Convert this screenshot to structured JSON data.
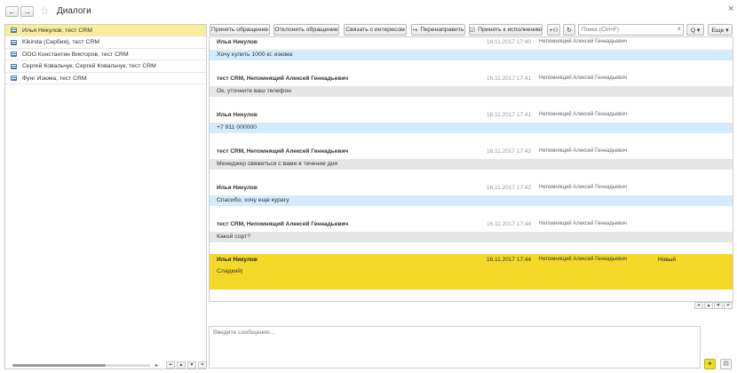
{
  "window": {
    "title": "Диалоги",
    "close": "×"
  },
  "nav": {
    "back": "←",
    "forward": "→",
    "star": "☆"
  },
  "toolbar": {
    "accept": "Принять обращение",
    "reject": "Отклонить обращение",
    "link_interest": "Связать с интересом",
    "redirect": "Перенаправить",
    "accept_exec": "Принять к исполнению",
    "search_placeholder": "Поиск (Ctrl+F)",
    "search_clear": "×",
    "search_btn": "Q ▾",
    "more": "Еще ▾"
  },
  "dialogs": [
    {
      "label": "Илья Никулов, тест CRM"
    },
    {
      "label": "Kikinda (Сербия), тест CRM"
    },
    {
      "label": "ООО Константин Викторов, тест CRM"
    },
    {
      "label": "Сергей Ковальчук, Сергей Ковальчук, тест CRM"
    },
    {
      "label": "Фунг Изюма, тест CRM"
    }
  ],
  "messages": [
    {
      "author": "Илья Никулов",
      "time": "16.11.2017 17:40",
      "responsible": "Непомнящий Алексей Геннадьевич",
      "text": "Хочу купить 1000 кг. изюма",
      "status": ""
    },
    {
      "author": "тест CRM, Непомнящий Алексей Геннадьевич",
      "time": "16.11.2017 17:41",
      "responsible": "Непомнящий Алексей Геннадьевич",
      "text": "Ок, уточните ваш телефон",
      "status": ""
    },
    {
      "author": "Илья Никулов",
      "time": "16.11.2017 17:41",
      "responsible": "Непомнящий Алексей Геннадьевич",
      "text": "+7 911 000000",
      "status": ""
    },
    {
      "author": "тест CRM, Непомнящий Алексей Геннадьевич",
      "time": "16.11.2017 17:42",
      "responsible": "Непомнящий Алексей Геннадьевич",
      "text": "Менеджер свяжеться с вами в течение дня",
      "status": ""
    },
    {
      "author": "Илья Никулов",
      "time": "16.11.2017 17:42",
      "responsible": "Непомнящий Алексей Геннадьевич",
      "text": "Спасибо, хочу еще курагу",
      "status": ""
    },
    {
      "author": "тест CRM, Непомнящий Алексей Геннадьевич",
      "time": "16.11.2017 17:44",
      "responsible": "Непомнящий Алексей Геннадьевич",
      "text": "Какой сорт?",
      "status": ""
    },
    {
      "author": "Илья Никулов",
      "time": "16.11.2017 17:44",
      "responsible": "Непомнящий Алексей Геннадьевич",
      "text": "Сладкий)",
      "status": "Новый"
    }
  ],
  "compose": {
    "placeholder": "Введите сообщение..."
  },
  "colors": {
    "selected_row": "#fbeb9d",
    "incoming": "#d3ebfb",
    "outgoing": "#e6e6e6",
    "highlight": "#f5d928",
    "accent": "#3e7ab8"
  }
}
